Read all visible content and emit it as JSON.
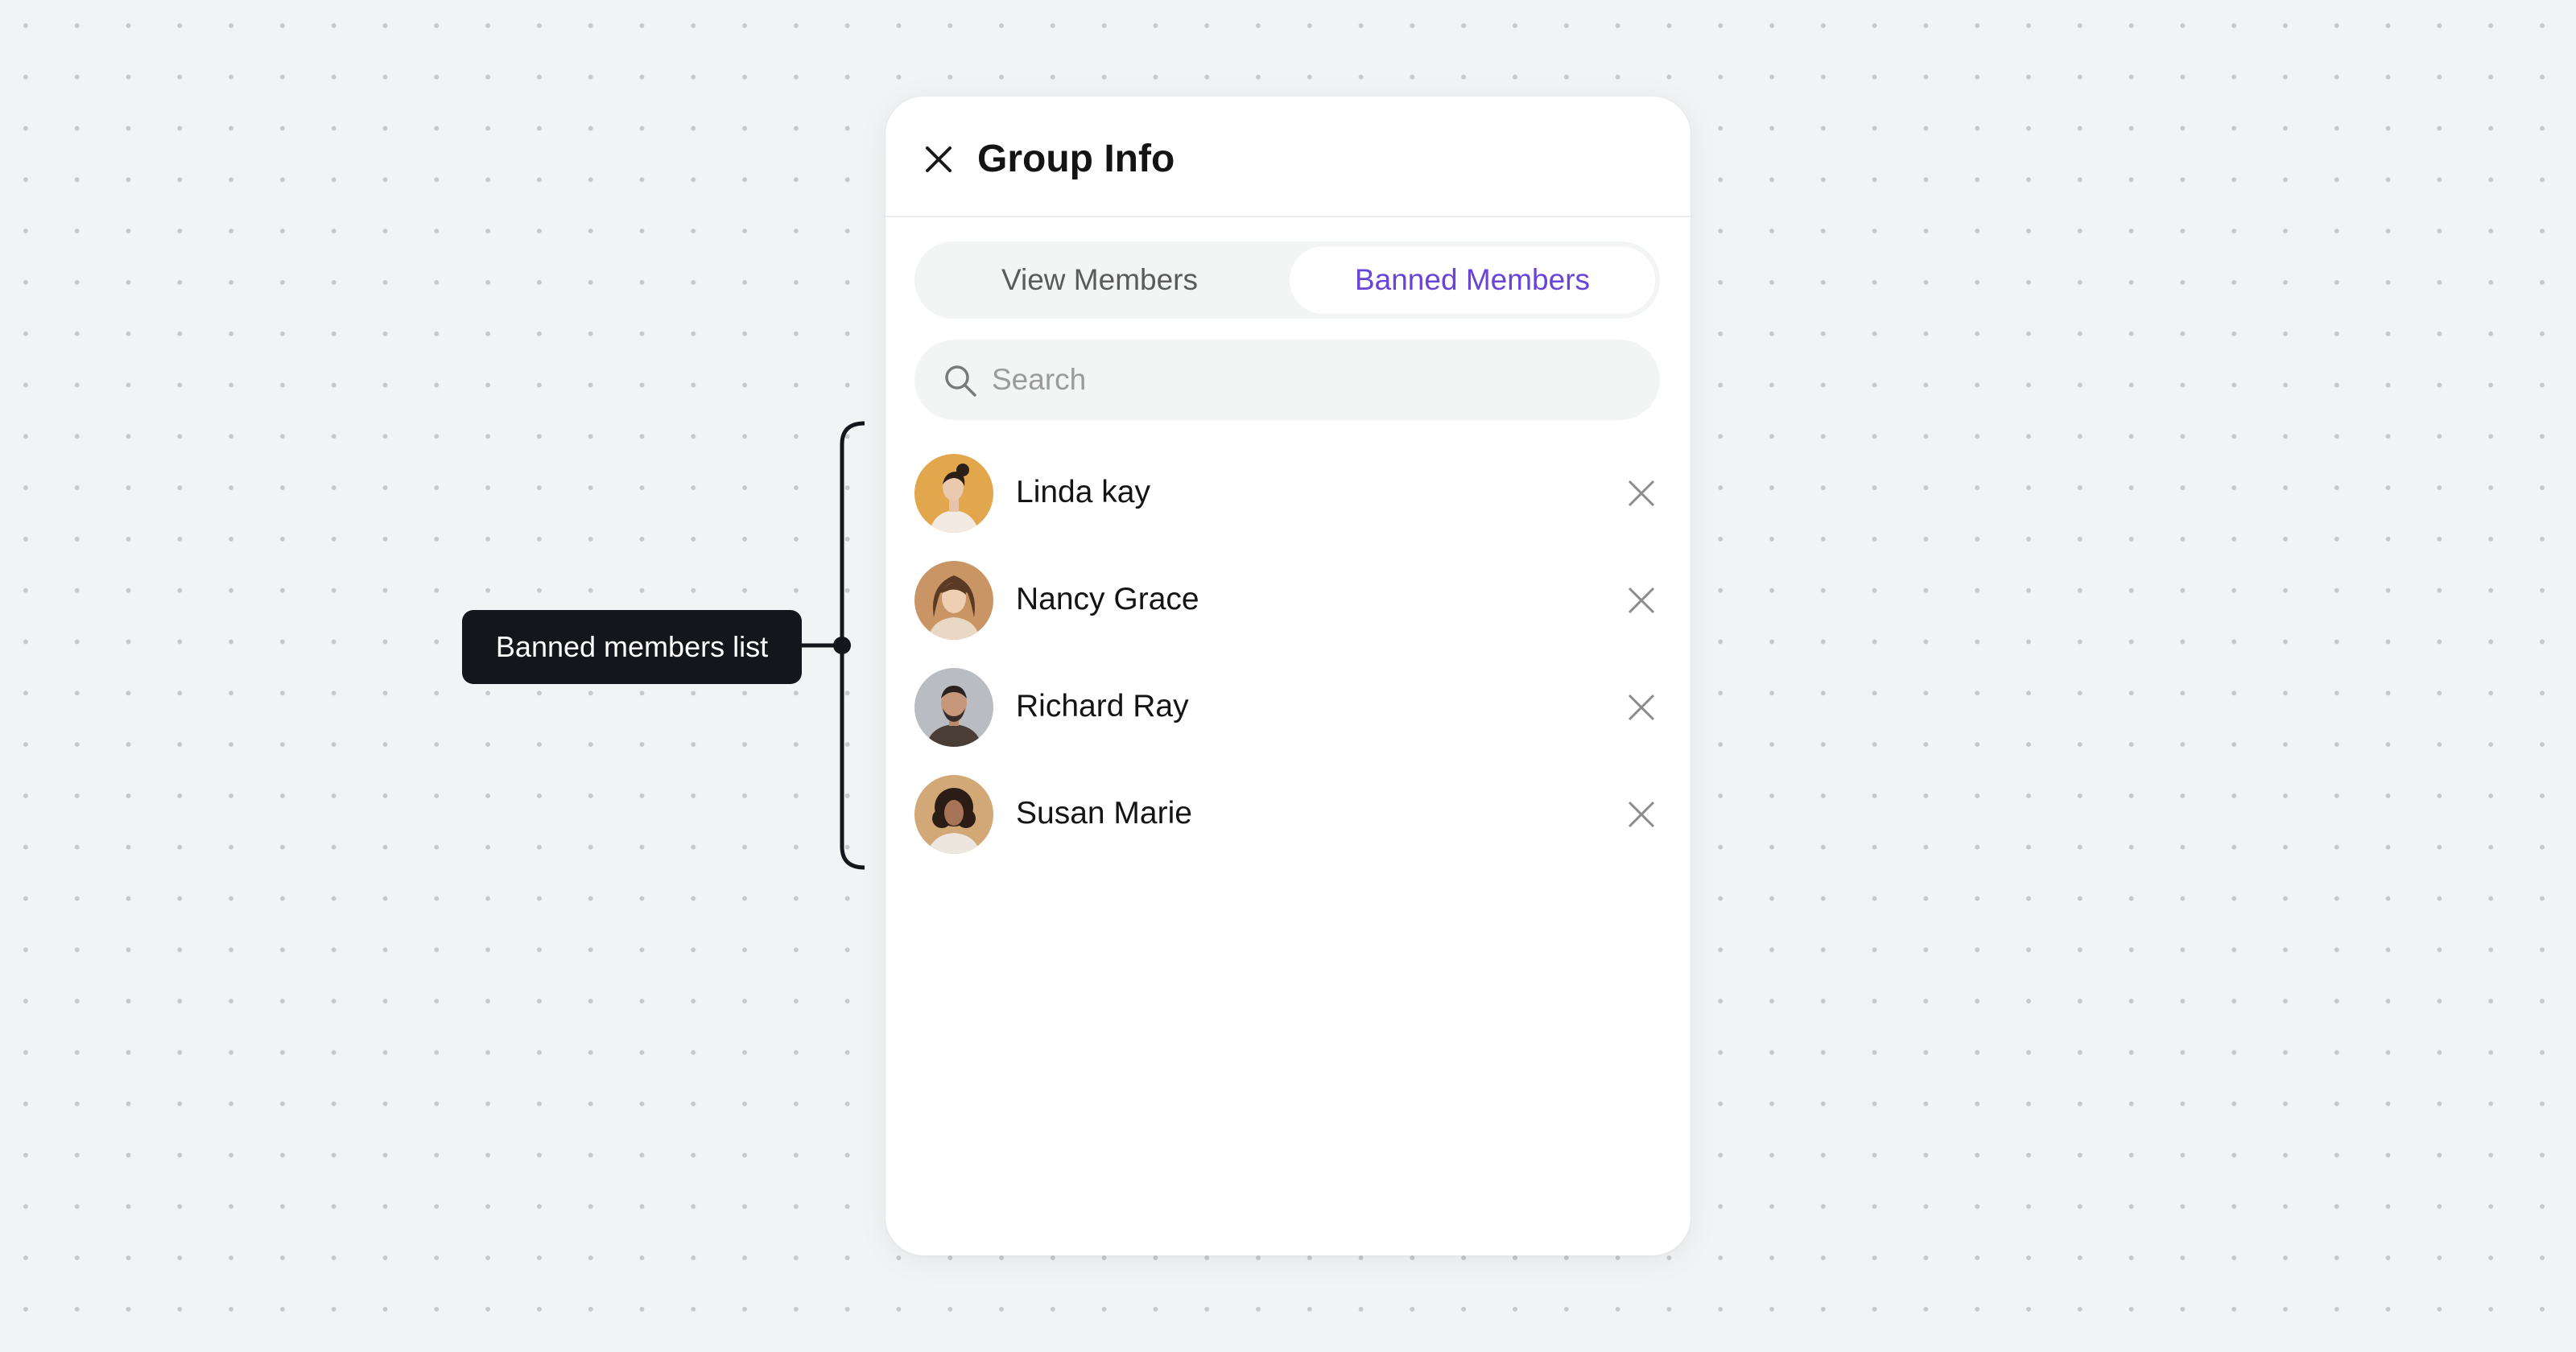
{
  "panel": {
    "title": "Group Info",
    "close_icon": "close-icon"
  },
  "tabs": [
    {
      "label": "View Members",
      "active": false
    },
    {
      "label": "Banned Members",
      "active": true
    }
  ],
  "search": {
    "placeholder": "Search",
    "value": "",
    "icon": "search-icon"
  },
  "banned_members": [
    {
      "name": "Linda kay",
      "action_icon": "close-icon"
    },
    {
      "name": "Nancy Grace",
      "action_icon": "close-icon"
    },
    {
      "name": "Richard Ray",
      "action_icon": "close-icon"
    },
    {
      "name": "Susan Marie",
      "action_icon": "close-icon"
    }
  ],
  "annotation": {
    "label": "Banned members list"
  },
  "colors": {
    "accent": "#6a44d6",
    "background": "#f2f3f5",
    "panel": "#ffffff",
    "annotation": "#15161c"
  }
}
